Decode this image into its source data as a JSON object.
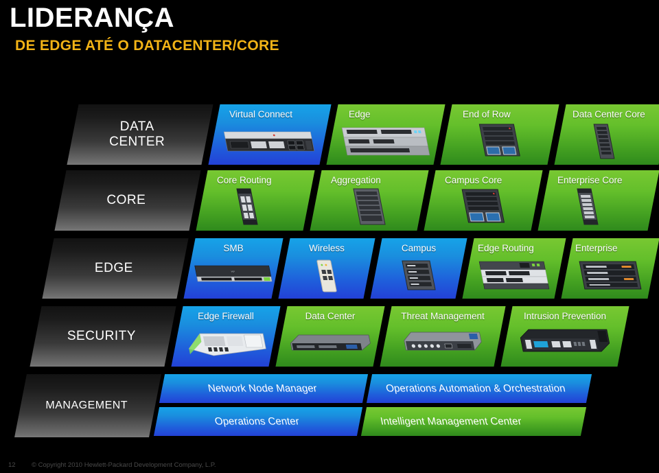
{
  "title": {
    "main": "LIDERANÇA",
    "sub": "DE EDGE ATÉ O DATACENTER/CORE",
    "main_color": "#ffffff",
    "sub_color": "#f2b316"
  },
  "colors": {
    "green": "#64bf2b",
    "blue": "#1a8ede",
    "label_grey": "#3a3a3a",
    "background": "#000000"
  },
  "rows": [
    {
      "label": "DATA\nCENTER",
      "label_line1": "DATA",
      "label_line2": "CENTER",
      "cells": [
        {
          "label": "Virtual Connect",
          "color": "blue",
          "device": "rack-server"
        },
        {
          "label": "Edge",
          "color": "green",
          "device": "stacked-switch"
        },
        {
          "label": "End of Row",
          "color": "green",
          "device": "chassis-switch"
        },
        {
          "label": "Data Center Core",
          "color": "green",
          "device": "tall-chassis"
        }
      ]
    },
    {
      "label": "CORE",
      "cells": [
        {
          "label": "Core Routing",
          "color": "green",
          "device": "tall-chassis"
        },
        {
          "label": "Aggregation",
          "color": "green",
          "device": "chassis-switch"
        },
        {
          "label": "Campus Core",
          "color": "green",
          "device": "big-chassis"
        },
        {
          "label": "Enterprise Core",
          "color": "green",
          "device": "tall-chassis"
        }
      ]
    },
    {
      "label": "EDGE",
      "cells": [
        {
          "label": "SMB",
          "color": "blue",
          "device": "1u-switch"
        },
        {
          "label": "Wireless",
          "color": "blue",
          "device": "access-point"
        },
        {
          "label": "Campus",
          "color": "blue",
          "device": "stack-box"
        },
        {
          "label": "Edge Routing",
          "color": "green",
          "device": "router-stack"
        },
        {
          "label": "Enterprise",
          "color": "green",
          "device": "big-chassis"
        }
      ]
    },
    {
      "label": "SECURITY",
      "cells": [
        {
          "label": "Edge Firewall",
          "color": "blue",
          "device": "firewall-blade"
        },
        {
          "label": "Data Center",
          "color": "green",
          "device": "1u-appliance"
        },
        {
          "label": "Threat Management",
          "color": "green",
          "device": "1u-appliance-ports"
        },
        {
          "label": "Intrusion Prevention",
          "color": "green",
          "device": "2u-appliance"
        }
      ]
    },
    {
      "label": "MANAGEMENT",
      "cells": [
        {
          "label": "Network Node Manager",
          "color": "blue",
          "align": "center"
        },
        {
          "label": "Operations Automation & Orchestration",
          "color": "blue",
          "align": "left"
        },
        {
          "label": "Operations Center",
          "color": "blue",
          "align": "center"
        },
        {
          "label": "Intelligent Management Center",
          "color": "green",
          "align": "left"
        }
      ]
    }
  ],
  "footer": {
    "page_number": "12",
    "copyright": "© Copyright 2010 Hewlett-Packard Development Company, L.P."
  }
}
